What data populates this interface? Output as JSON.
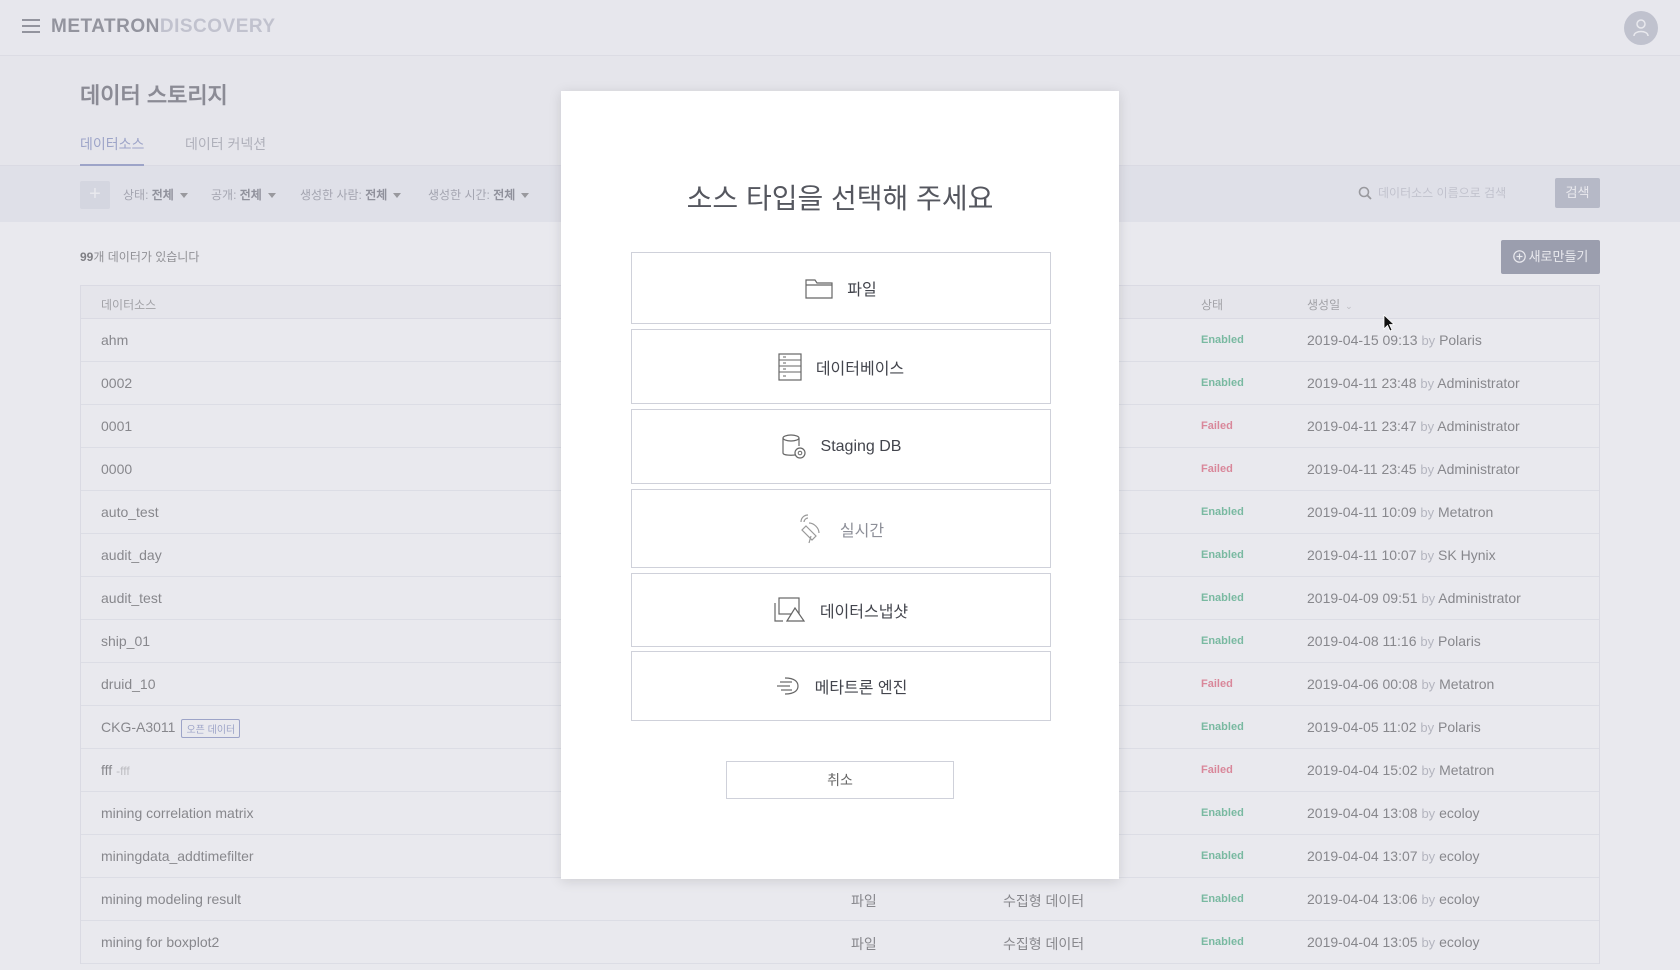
{
  "header": {
    "logo_part1": "METATRON",
    "logo_part2": "DISCOVERY"
  },
  "page": {
    "title": "데이터 스토리지",
    "tabs": [
      {
        "label": "데이터소스",
        "active": true
      },
      {
        "label": "데이터 커넥션",
        "active": false
      }
    ]
  },
  "filters": [
    {
      "label": "상태:",
      "value": "전체"
    },
    {
      "label": "공개:",
      "value": "전체"
    },
    {
      "label": "생성한 사람:",
      "value": "전체"
    },
    {
      "label": "생성한 시간:",
      "value": "전체"
    }
  ],
  "search": {
    "placeholder": "데이터소스 이름으로 검색",
    "button_label": "검색"
  },
  "list": {
    "count_number": "99",
    "count_suffix": "개 데이터가 있습니다",
    "new_button_label": "새로만들기",
    "columns": {
      "name": "데이터소스",
      "status": "상태",
      "created": "생성일"
    },
    "rows": [
      {
        "name": "ahm",
        "type": "",
        "kind": "",
        "status": "Enabled",
        "date": "2019-04-15 09:13",
        "by": "by",
        "user": "Polaris"
      },
      {
        "name": "0002",
        "type": "",
        "kind": "",
        "status": "Enabled",
        "date": "2019-04-11 23:48",
        "by": "by",
        "user": "Administrator"
      },
      {
        "name": "0001",
        "type": "",
        "kind": "",
        "status": "Failed",
        "date": "2019-04-11 23:47",
        "by": "by",
        "user": "Administrator"
      },
      {
        "name": "0000",
        "type": "",
        "kind": "",
        "status": "Failed",
        "date": "2019-04-11 23:45",
        "by": "by",
        "user": "Administrator"
      },
      {
        "name": "auto_test",
        "type": "",
        "kind": "",
        "status": "Enabled",
        "date": "2019-04-11 10:09",
        "by": "by",
        "user": "Metatron"
      },
      {
        "name": "audit_day",
        "type": "",
        "kind": "",
        "status": "Enabled",
        "date": "2019-04-11 10:07",
        "by": "by",
        "user": "SK Hynix"
      },
      {
        "name": "audit_test",
        "type": "",
        "kind": "",
        "status": "Enabled",
        "date": "2019-04-09 09:51",
        "by": "by",
        "user": "Administrator"
      },
      {
        "name": "ship_01",
        "type": "",
        "kind": "",
        "status": "Enabled",
        "date": "2019-04-08 11:16",
        "by": "by",
        "user": "Polaris"
      },
      {
        "name": "druid_10",
        "type": "",
        "kind": "",
        "status": "Failed",
        "date": "2019-04-06 00:08",
        "by": "by",
        "user": "Metatron"
      },
      {
        "name": "CKG-A3011",
        "badge": "오픈 데이터",
        "type": "",
        "kind": "",
        "status": "Enabled",
        "date": "2019-04-05 11:02",
        "by": "by",
        "user": "Polaris"
      },
      {
        "name": "fff",
        "desc": "-fff",
        "type": "",
        "kind": "",
        "status": "Failed",
        "date": "2019-04-04 15:02",
        "by": "by",
        "user": "Metatron"
      },
      {
        "name": "mining correlation matrix",
        "type": "",
        "kind": "",
        "status": "Enabled",
        "date": "2019-04-04 13:08",
        "by": "by",
        "user": "ecoloy"
      },
      {
        "name": "miningdata_addtimefilter",
        "type": "",
        "kind": "",
        "status": "Enabled",
        "date": "2019-04-04 13:07",
        "by": "by",
        "user": "ecoloy"
      },
      {
        "name": "mining modeling result",
        "type": "파일",
        "kind": "수집형 데이터",
        "status": "Enabled",
        "date": "2019-04-04 13:06",
        "by": "by",
        "user": "ecoloy"
      },
      {
        "name": "mining for boxplot2",
        "type": "파일",
        "kind": "수집형 데이터",
        "status": "Enabled",
        "date": "2019-04-04 13:05",
        "by": "by",
        "user": "ecoloy"
      }
    ]
  },
  "modal": {
    "title": "소스 타입을 선택해 주세요",
    "options": [
      {
        "label": "파일",
        "icon": "folder-icon"
      },
      {
        "label": "데이터베이스",
        "icon": "database-icon"
      },
      {
        "label": "Staging DB",
        "icon": "staging-db-icon"
      },
      {
        "label": "실시간",
        "icon": "satellite-icon"
      },
      {
        "label": "데이터스냅샷",
        "icon": "snapshot-icon"
      },
      {
        "label": "메타트론 엔진",
        "icon": "engine-icon"
      }
    ],
    "cancel_label": "취소"
  },
  "colors": {
    "accent": "#6e7bb6",
    "enabled": "#2aa46b",
    "failed": "#e0445e"
  }
}
